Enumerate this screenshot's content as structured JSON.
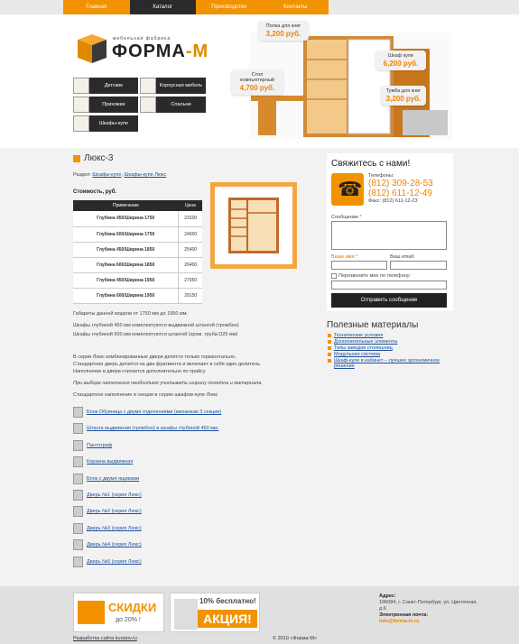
{
  "nav": [
    {
      "label": "Главная",
      "active": false
    },
    {
      "label": "Каталог",
      "active": true
    },
    {
      "label": "Производство",
      "active": false
    },
    {
      "label": "Контакты",
      "active": false
    }
  ],
  "logo": {
    "small": "мебельная фабрика",
    "big_a": "ФОРМА",
    "big_b": "-М"
  },
  "categories": [
    "Детские",
    "Корпусная мебель",
    "Прихожие",
    "Спальни",
    "Шкафы-купе"
  ],
  "promo": [
    {
      "title": "Полка для книг",
      "price": "3,200 руб."
    },
    {
      "title": "Стол компьютерный",
      "price": "4,700 руб."
    },
    {
      "title": "Шкаф купе",
      "price": "6,200 руб."
    },
    {
      "title": "Тумба для книг",
      "price": "3,200 руб."
    }
  ],
  "page": {
    "title": "Люкс-3",
    "section_label": "Раздел:",
    "section_link1": "Шкафы-купе",
    "section_link2": "Шкафы-купе Люкс",
    "cost_label": "Стоимость, руб.",
    "table_headers": [
      "Примечание",
      "Цена"
    ],
    "table_rows": [
      [
        "Глубина 450/Ширина 1750",
        "23100"
      ],
      [
        "Глубина 600/Ширина 1750",
        "24000"
      ],
      [
        "Глубина 450/Ширина 1850",
        "25400"
      ],
      [
        "Глубина 600/Ширина 1850",
        "26400"
      ],
      [
        "Глубина 450/Ширина 1950",
        "27950"
      ],
      [
        "Глубина 600/Ширина 1950",
        "29150"
      ]
    ],
    "para1": "Габариты данной модели от 1750 мм до 1950 мм.",
    "para2": "Шкафы глубиной 450 мм комплектуются выдвижной штангой (тромбон)",
    "para3": "Шкафы глубиной 600 мм комплектуются штангой (хром. труба D25 мм)",
    "para4a": "В серии Люкс комбинированные двери делятся только горизонтально.",
    "para4b": "Стандартная дверь делится на два фрагмента и включает в себя один делитель.",
    "para4c": "Наполнение в двери считается дополнительно по прайсу",
    "para5": "При выборе наполнения необходимо учитывать ширину полотна и материала.",
    "para6": "Стандартное наполнение в секции в серию шкафов-купе Люкс",
    "fill_items": [
      "Блок Обувница с двумя отделениями (механизм 3 секции)",
      "Штанга выдвижная (тромбон) в шкафы глубиной 450 мм.",
      "Пантограф",
      "Корзина выдвижная",
      "Блок с двумя ящиками",
      "Дверь №1 (серия Люкс)",
      "Дверь №2 (серия Люкс)",
      "Дверь №3 (серия Люкс)",
      "Дверь №4 (серия Люкс)",
      "Дверь №5 (серия Люкс)"
    ]
  },
  "contact": {
    "title": "Свяжитесь с нами!",
    "phones_label": "Телефоны:",
    "phone1": "(812) 309-28-53",
    "phone2": "(812) 611-12-49",
    "fax": "Факс: (812) 611-12-23",
    "message_label": "Сообщение",
    "name_label": "Ваше имя",
    "email_label": "Ваш email:",
    "callback_label": "Перезвоните мне по телефону:",
    "submit": "Отправить сообщение"
  },
  "related": {
    "title": "Полезные материалы",
    "items": [
      "Технические условия",
      "Дополнительные элементы",
      "Типы заводов столешниц",
      "Модульная система",
      "Шкаф-купе в кабинет – лучшее эргономичное решение"
    ]
  },
  "footer": {
    "banner1_t1": "СКИДКИ",
    "banner1_t2": "до 20% !",
    "banner2_t1": "10% бесплатно!",
    "banner2_t2": "АКЦИЯ!",
    "addr_label": "Адрес:",
    "addr": "196084, г. Санкт-Петербург, ул. Цветочная, д.6",
    "email_label": "Электронная почта:",
    "email": "info@forma-m.ru",
    "dev": "Разработка сайта kuratov.ru",
    "copyright": "© 2010 «Форма-М»"
  },
  "colors": {
    "accent": "#f39200",
    "dark": "#2a2a2a",
    "link": "#1a4f9c"
  }
}
